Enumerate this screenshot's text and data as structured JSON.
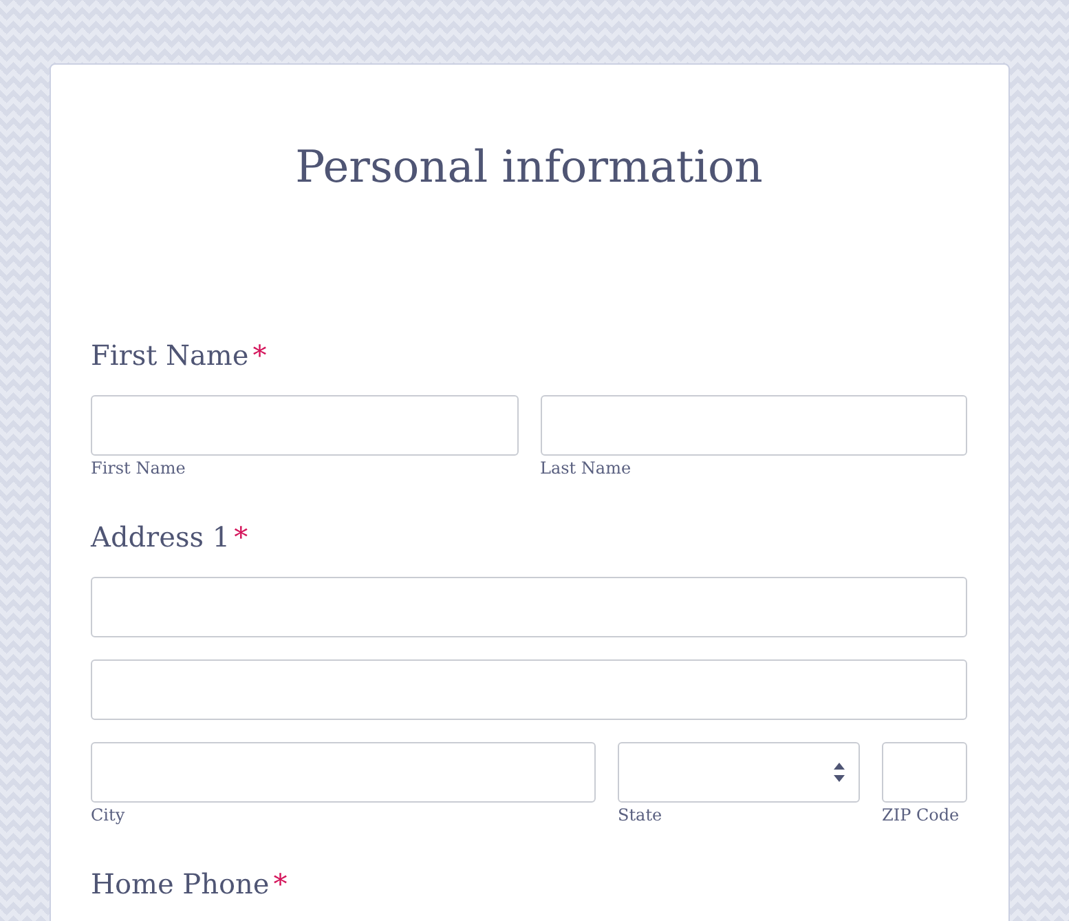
{
  "form": {
    "title": "Personal information",
    "fields": [
      {
        "label": "First Name",
        "required_mark": "*",
        "rows": [
          [
            {
              "kind": "text",
              "sublabel": "First Name"
            },
            {
              "kind": "text",
              "sublabel": "Last Name"
            }
          ]
        ]
      },
      {
        "label": "Address 1",
        "required_mark": "*",
        "rows": [
          [
            {
              "kind": "text"
            }
          ],
          [
            {
              "kind": "text"
            }
          ],
          [
            {
              "kind": "text",
              "sublabel": "City"
            },
            {
              "kind": "select",
              "sublabel": "State"
            },
            {
              "kind": "short",
              "sublabel": "ZIP Code"
            }
          ]
        ]
      },
      {
        "label": "Home Phone",
        "required_mark": "*"
      }
    ]
  }
}
